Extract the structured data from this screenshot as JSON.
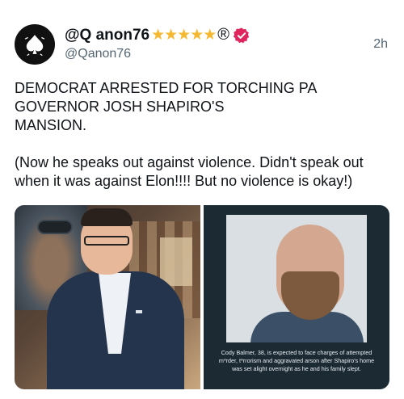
{
  "post": {
    "display_name": "@Q anon76",
    "stars": "★★★★★",
    "registered_mark": "®",
    "handle": "@Qanon76",
    "timestamp": "2h",
    "text_lines": [
      "DEMOCRAT ARRESTED FOR TORCHING PA",
      "GOVERNOR JOSH SHAPIRO'S",
      "MANSION.",
      "",
      "(Now he speaks out against violence. Didn't speak out",
      "when it was against Elon!!!! But no violence is okay!)"
    ],
    "media": {
      "right_caption": "Cody Balmer, 38, is expected to face charges of attempted m*rder, t*rrorism and aggravated arson after Shapiro's home was set alight overnight as he and his family slept."
    }
  },
  "colors": {
    "verified_badge": "#e0245e",
    "stars": "#f5b82e",
    "secondary_text": "#536471"
  },
  "icons": {
    "avatar": "spade-logo-icon",
    "verified": "verified-badge-icon"
  }
}
